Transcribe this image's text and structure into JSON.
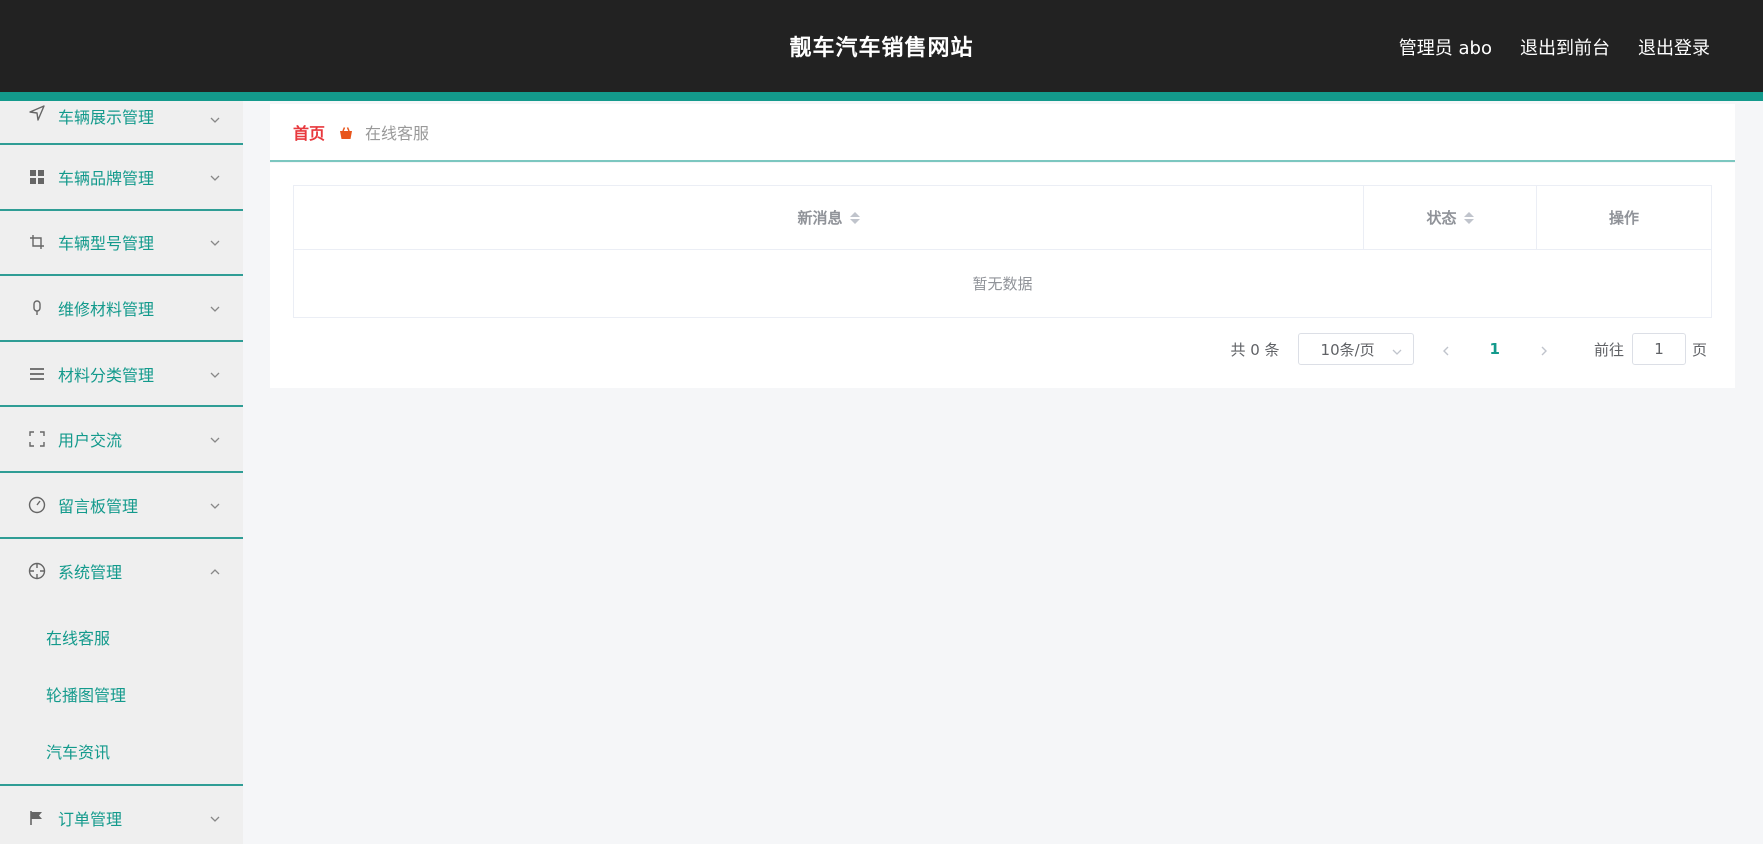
{
  "header": {
    "title": "靓车汽车销售网站",
    "links": [
      "管理员 abo",
      "退出到前台",
      "退出登录"
    ]
  },
  "sidebar": {
    "items": [
      {
        "label": "车辆展示管理",
        "icon": "navigation-icon"
      },
      {
        "label": "车辆品牌管理",
        "icon": "grid-icon"
      },
      {
        "label": "车辆型号管理",
        "icon": "crop-icon"
      },
      {
        "label": "维修材料管理",
        "icon": "microphone-icon"
      },
      {
        "label": "材料分类管理",
        "icon": "list-icon"
      },
      {
        "label": "用户交流",
        "icon": "full-screen-icon"
      },
      {
        "label": "留言板管理",
        "icon": "gauge-icon"
      },
      {
        "label": "系统管理",
        "icon": "crosshair-icon",
        "expanded": true,
        "children": [
          "在线客服",
          "轮播图管理",
          "汽车资讯"
        ]
      },
      {
        "label": "订单管理",
        "icon": "flag-icon"
      }
    ]
  },
  "breadcrumb": {
    "home": "首页",
    "current": "在线客服"
  },
  "table": {
    "columns": [
      "新消息",
      "状态",
      "操作"
    ],
    "empty_text": "暂无数据"
  },
  "pagination": {
    "total": "共 0 条",
    "page_size": "10条/页",
    "current_page": "1",
    "goto_label": "前往",
    "goto_value": "1",
    "page_unit": "页"
  },
  "colors": {
    "header_bg": "#222222",
    "accent": "#139a8c",
    "home_crumb": "#e8383d"
  }
}
